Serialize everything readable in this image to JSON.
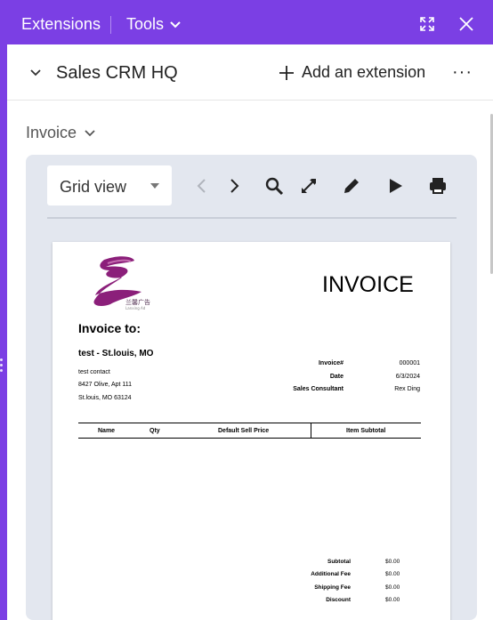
{
  "header": {
    "title": "Extensions",
    "tools_label": "Tools"
  },
  "base": {
    "name": "Sales CRM HQ",
    "add_extension_label": "Add an extension",
    "more_label": "···"
  },
  "extension": {
    "selected": "Invoice"
  },
  "toolbar": {
    "view_label": "Grid view"
  },
  "invoice": {
    "logo_text": "兰馨广告",
    "logo_subtext": "Lanxing Ad",
    "title": "INVOICE",
    "invoice_to_label": "Invoice to:",
    "customer_name": "test - St.louis, MO",
    "contact": "test contact",
    "address_line1": "8427 Olive, Apt 111",
    "address_line2": "St.louis, MO 63124",
    "meta": [
      {
        "label": "Invoice#",
        "value": "000001"
      },
      {
        "label": "Date",
        "value": "6/3/2024"
      },
      {
        "label": "Sales Consultant",
        "value": "Rex Ding"
      }
    ],
    "columns": [
      "Name",
      "Qty",
      "Default Sell Price",
      "Item Subtotal"
    ],
    "totals": [
      {
        "label": "Subtotal",
        "value": "$0.00"
      },
      {
        "label": "Additional Fee",
        "value": "$0.00"
      },
      {
        "label": "Shipping Fee",
        "value": "$0.00"
      },
      {
        "label": "Discount",
        "value": "$0.00"
      }
    ]
  },
  "colors": {
    "accent": "#7b3fe4",
    "panel_bg": "#ffffff",
    "card_bg": "#e3e7ef",
    "logo": "#8b1f7a"
  },
  "icons": [
    "expand-icon",
    "close-icon",
    "chevron-down-icon",
    "plus-icon",
    "more-icon",
    "chevron-left-icon",
    "chevron-right-icon",
    "search-icon",
    "fullscreen-icon",
    "edit-icon",
    "play-icon",
    "print-icon"
  ]
}
